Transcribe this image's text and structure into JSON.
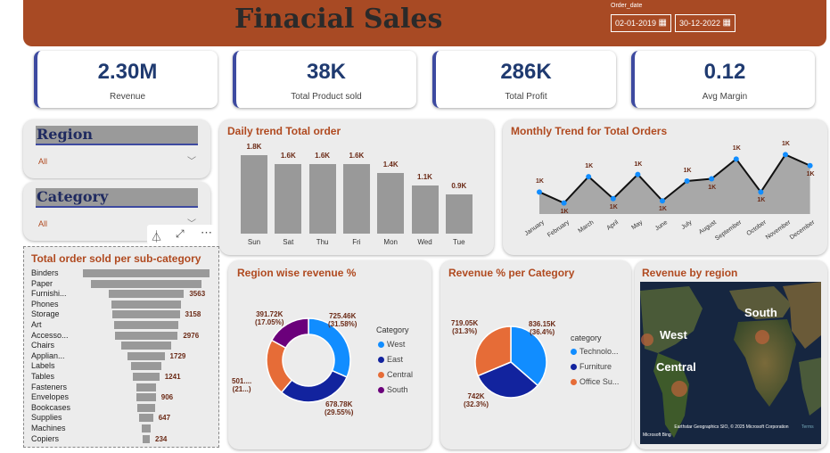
{
  "header": {
    "title": "Finacial Sales",
    "date_label": "Order_date",
    "date_from": "02-01-2019",
    "date_to": "30-12-2022",
    "bg": "#a84a24"
  },
  "kpis": [
    {
      "value": "2.30M",
      "label": "Revenue"
    },
    {
      "value": "38K",
      "label": "Total Product sold"
    },
    {
      "value": "286K",
      "label": "Total Profit"
    },
    {
      "value": "0.12",
      "label": "Avg Margin"
    }
  ],
  "slicers": {
    "region": {
      "title": "Region",
      "value": "All"
    },
    "category": {
      "title": "Category",
      "value": "All"
    }
  },
  "daily": {
    "title": "Daily trend Total order"
  },
  "monthly": {
    "title": "Monthly Trend for Total Orders"
  },
  "subcat": {
    "title": "Total order sold per sub-category"
  },
  "region_rev": {
    "title": "Region wise revenue %",
    "legend_title": "Category"
  },
  "cat_rev": {
    "title": "Revenue % per Category",
    "legend_title": "category"
  },
  "map": {
    "title": "Revenue by region",
    "labels": [
      "West",
      "South",
      "Central"
    ],
    "attribution": "Earthstar Geographics SIO, © 2025 Microsoft Corporation",
    "terms": "Terms",
    "brand": "Microsoft Bing"
  },
  "chart_data": [
    {
      "type": "bar",
      "title": "Daily trend Total order",
      "categories": [
        "Sun",
        "Sat",
        "Thu",
        "Fri",
        "Mon",
        "Wed",
        "Tue"
      ],
      "values": [
        1800,
        1600,
        1600,
        1600,
        1400,
        1100,
        900
      ],
      "labels": [
        "1.8K",
        "1.6K",
        "1.6K",
        "1.6K",
        "1.4K",
        "1.1K",
        "0.9K"
      ]
    },
    {
      "type": "area",
      "title": "Monthly Trend for Total Orders",
      "categories": [
        "January",
        "February",
        "March",
        "April",
        "May",
        "June",
        "July",
        "August",
        "September",
        "October",
        "November",
        "December"
      ],
      "values": [
        1000,
        950,
        1070,
        970,
        1080,
        960,
        1050,
        1060,
        1150,
        1000,
        1170,
        1120
      ],
      "labels": [
        "1K",
        "1K",
        "1K",
        "1K",
        "1K",
        "1K",
        "1K",
        "1K",
        "1K",
        "1K",
        "1K",
        "1K"
      ]
    },
    {
      "type": "bar",
      "title": "Total order sold per sub-category",
      "categories": [
        "Binders",
        "Paper",
        "Furnishi...",
        "Phones",
        "Storage",
        "Art",
        "Accesso...",
        "Chairs",
        "Applian...",
        "Labels",
        "Tables",
        "Fasteners",
        "Envelopes",
        "Bookcases",
        "Supplies",
        "Machines",
        "Copiers"
      ],
      "values": [
        5974,
        5178,
        3563,
        3289,
        3158,
        3000,
        2976,
        2356,
        1729,
        1400,
        1241,
        914,
        906,
        868,
        647,
        440,
        234
      ],
      "labels": [
        "",
        "",
        "3563",
        "",
        "3158",
        "",
        "2976",
        "",
        "1729",
        "",
        "1241",
        "",
        "906",
        "",
        "647",
        "",
        "234"
      ]
    },
    {
      "type": "pie",
      "title": "Region wise revenue %",
      "categories": [
        "West",
        "East",
        "Central",
        "South"
      ],
      "values": [
        725.46,
        678.78,
        501.24,
        391.72
      ],
      "labels": [
        "725.46K (31.58%)",
        "678.78K (29.55%)",
        "501.... (21...)",
        "391.72K (17.05%)"
      ],
      "colors": [
        "#118dff",
        "#12239e",
        "#e66c37",
        "#6b007b"
      ]
    },
    {
      "type": "pie",
      "title": "Revenue % per Category",
      "categories": [
        "Technolo...",
        "Furniture",
        "Office Su..."
      ],
      "values": [
        836.15,
        742,
        719.05
      ],
      "labels": [
        "836.15K (36.4%)",
        "742K (32.3%)",
        "719.05K (31.3%)"
      ],
      "colors": [
        "#118dff",
        "#12239e",
        "#e66c37"
      ]
    }
  ]
}
